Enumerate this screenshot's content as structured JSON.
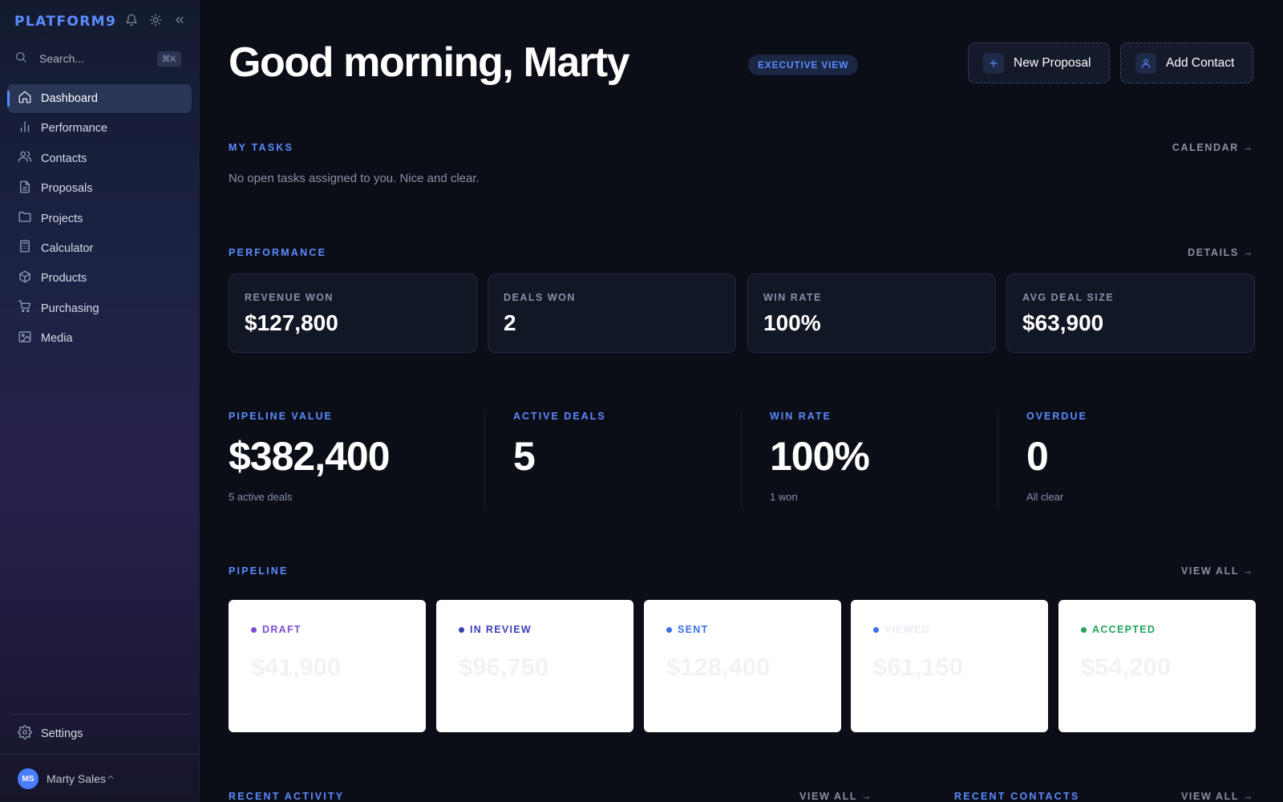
{
  "sidebar": {
    "brand": "PLATFORM9",
    "search": {
      "placeholder": "Search...",
      "shortcut": "⌘K"
    },
    "items": [
      {
        "label": "Dashboard",
        "icon": "home-icon",
        "active": true
      },
      {
        "label": "Performance",
        "icon": "bar-chart-icon"
      },
      {
        "label": "Contacts",
        "icon": "users-icon"
      },
      {
        "label": "Proposals",
        "icon": "file-text-icon"
      },
      {
        "label": "Projects",
        "icon": "folder-icon"
      },
      {
        "label": "Calculator",
        "icon": "calculator-icon"
      },
      {
        "label": "Products",
        "icon": "box-icon"
      },
      {
        "label": "Purchasing",
        "icon": "cart-icon"
      },
      {
        "label": "Media",
        "icon": "image-icon"
      }
    ],
    "settings_label": "Settings",
    "user": {
      "initials": "MS",
      "name": "Marty Sales"
    }
  },
  "header": {
    "greeting": "Good morning, Marty",
    "badge": "EXECUTIVE VIEW",
    "new_proposal": "New Proposal",
    "add_contact": "Add Contact"
  },
  "tasks": {
    "label": "MY TASKS",
    "link": "CALENDAR →",
    "empty": "No open tasks assigned to you. Nice and clear."
  },
  "performance": {
    "label": "PERFORMANCE",
    "link": "DETAILS →",
    "cards": [
      {
        "label": "REVENUE WON",
        "value": "$127,800"
      },
      {
        "label": "DEALS WON",
        "value": "2"
      },
      {
        "label": "WIN RATE",
        "value": "100%"
      },
      {
        "label": "AVG DEAL SIZE",
        "value": "$63,900"
      }
    ]
  },
  "kpis": [
    {
      "label": "PIPELINE VALUE",
      "value": "$382,400",
      "sub": "5 active deals"
    },
    {
      "label": "ACTIVE DEALS",
      "value": "5",
      "sub": ""
    },
    {
      "label": "WIN RATE",
      "value": "100%",
      "sub": "1 won"
    },
    {
      "label": "OVERDUE",
      "value": "0",
      "sub": "All clear"
    }
  ],
  "pipeline": {
    "label": "PIPELINE",
    "link": "VIEW ALL →",
    "stages": [
      {
        "name": "DRAFT",
        "amount": "$41,900",
        "count": "",
        "color": "#7c4ddb"
      },
      {
        "name": "IN REVIEW",
        "amount": "$96,750",
        "count": "",
        "color": "#3b3fb8"
      },
      {
        "name": "SENT",
        "amount": "$128,400",
        "count": "",
        "color": "#3b6fe6"
      },
      {
        "name": "VIEWED",
        "amount": "$61,150",
        "count": "",
        "color": "#e9ecf3"
      },
      {
        "name": "ACCEPTED",
        "amount": "$54,200",
        "count": "",
        "color": "#22a35a"
      }
    ]
  },
  "recent": {
    "activity_label": "RECENT ACTIVITY",
    "activity_link": "VIEW ALL →",
    "contacts_label": "RECENT CONTACTS",
    "contacts_link": "VIEW ALL →"
  },
  "colors": {
    "accent": "#5b8cff",
    "background": "#0b0e17",
    "card": "#121725"
  }
}
